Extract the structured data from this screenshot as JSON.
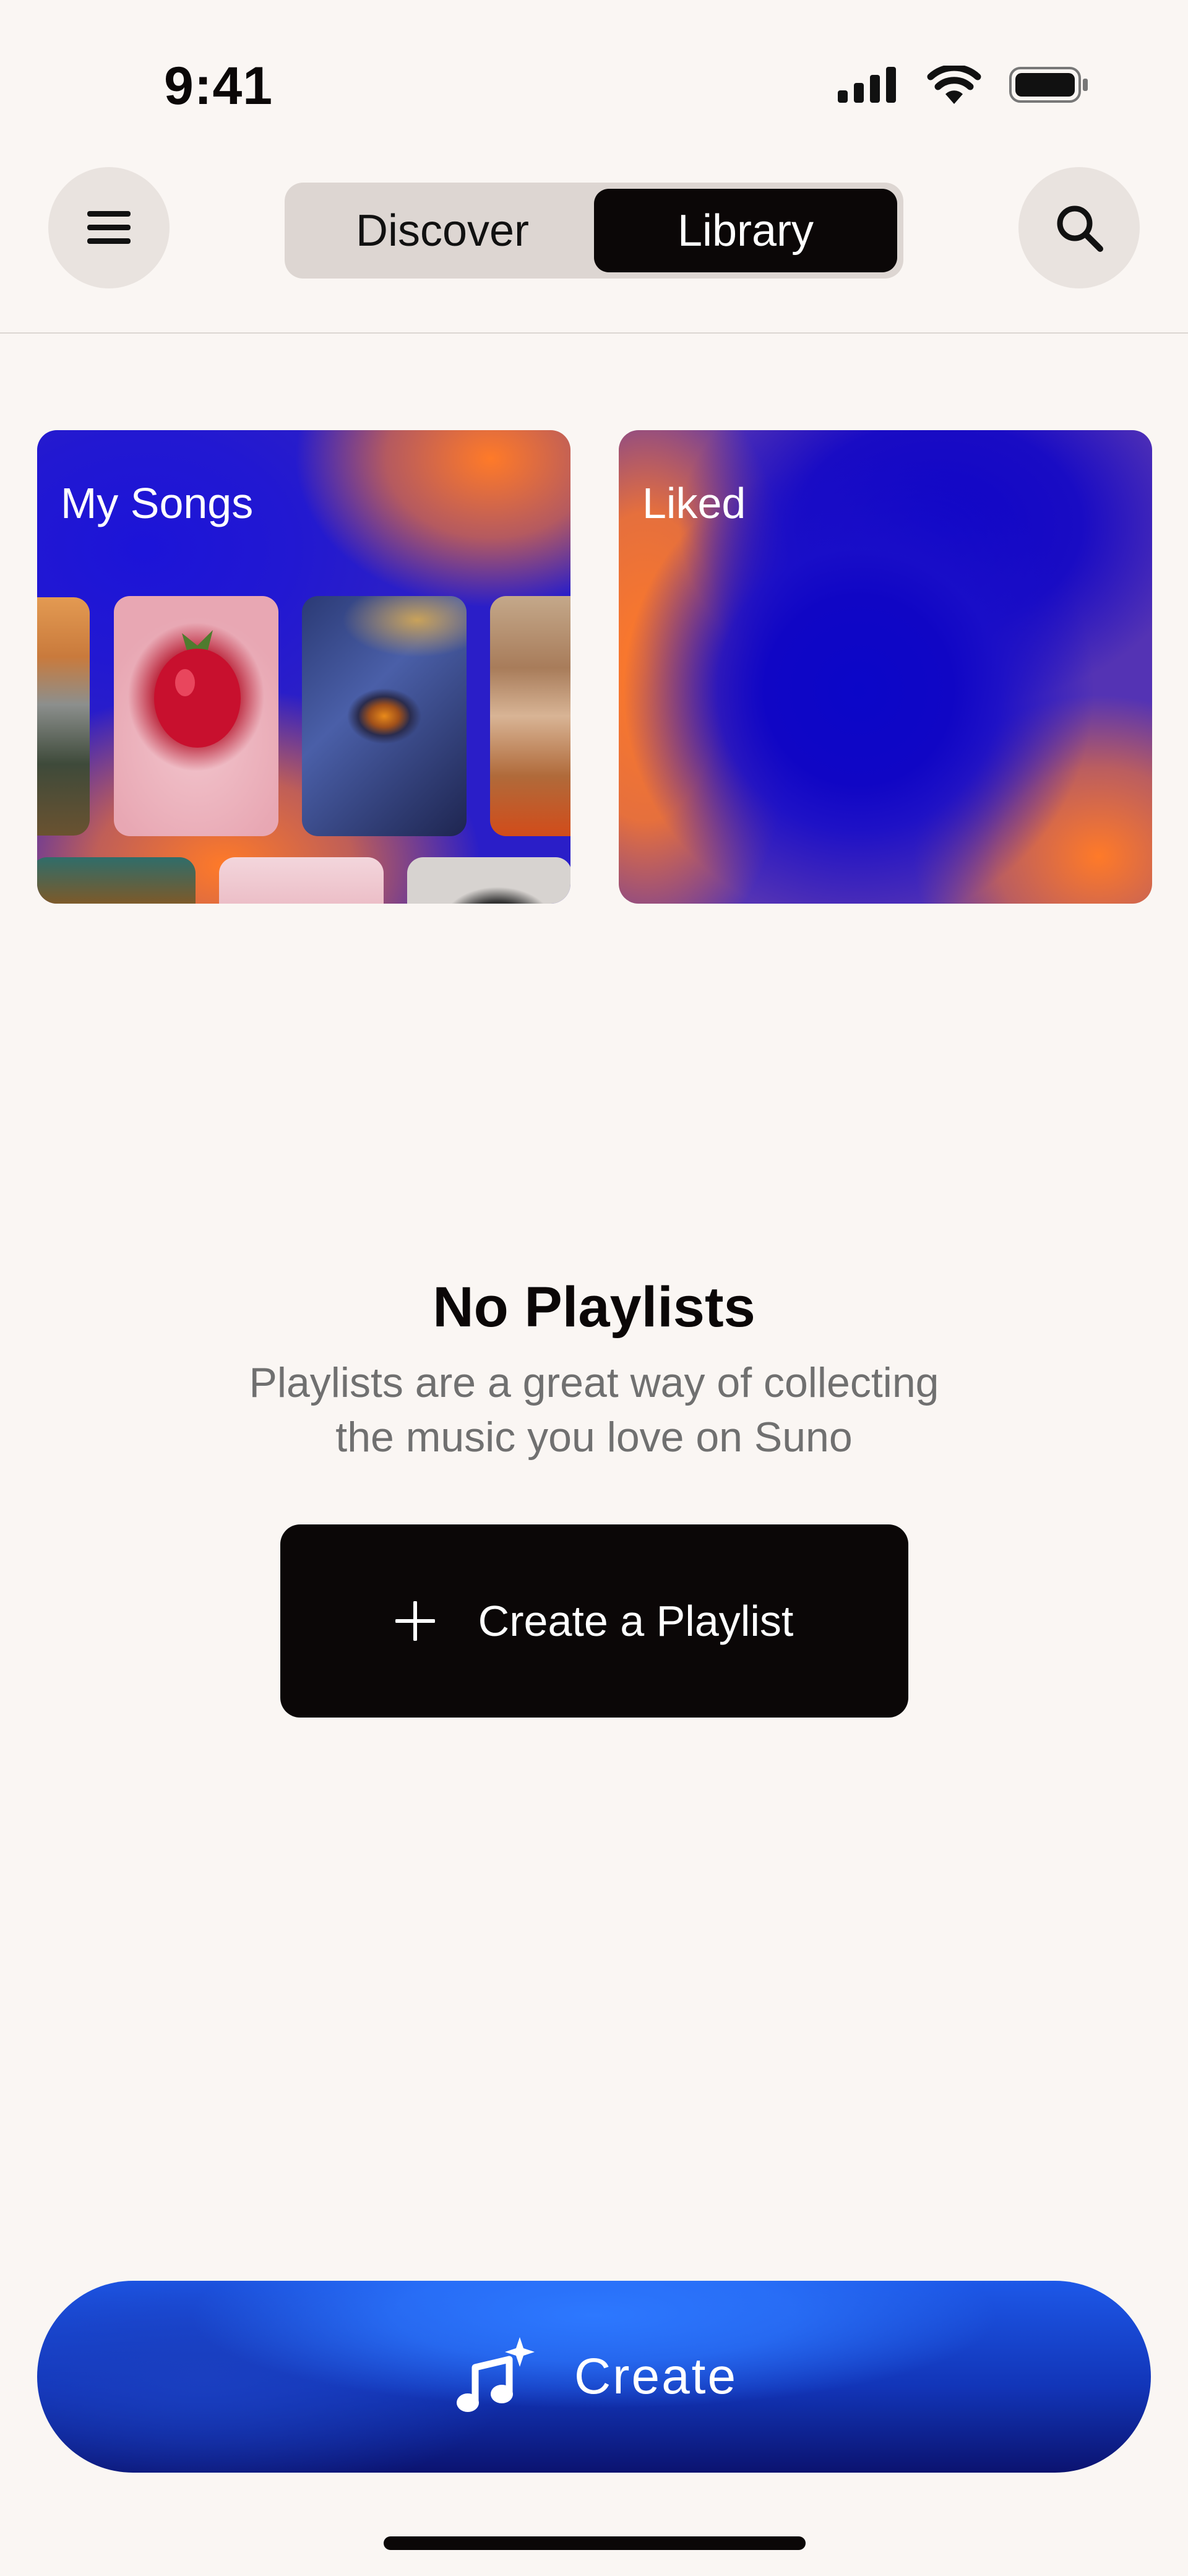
{
  "status_bar": {
    "time": "9:41"
  },
  "nav": {
    "tabs": [
      {
        "label": "Discover",
        "active": false
      },
      {
        "label": "Library",
        "active": true
      }
    ],
    "menu_icon": "hamburger-icon",
    "search_icon": "search-icon"
  },
  "cards": [
    {
      "title": "My Songs"
    },
    {
      "title": "Liked"
    }
  ],
  "empty_state": {
    "title": "No Playlists",
    "description_line1": "Playlists are a great way of collecting",
    "description_line2": "the music you love on Suno",
    "button_label": "Create a Playlist",
    "button_icon": "plus-icon"
  },
  "create_bar": {
    "label": "Create",
    "icon": "music-sparkle-icon"
  },
  "colors": {
    "accent_orange": "#ff7a28",
    "accent_blue": "#1f20d8",
    "ink": "#0b0707",
    "background": "#faf6f3"
  }
}
